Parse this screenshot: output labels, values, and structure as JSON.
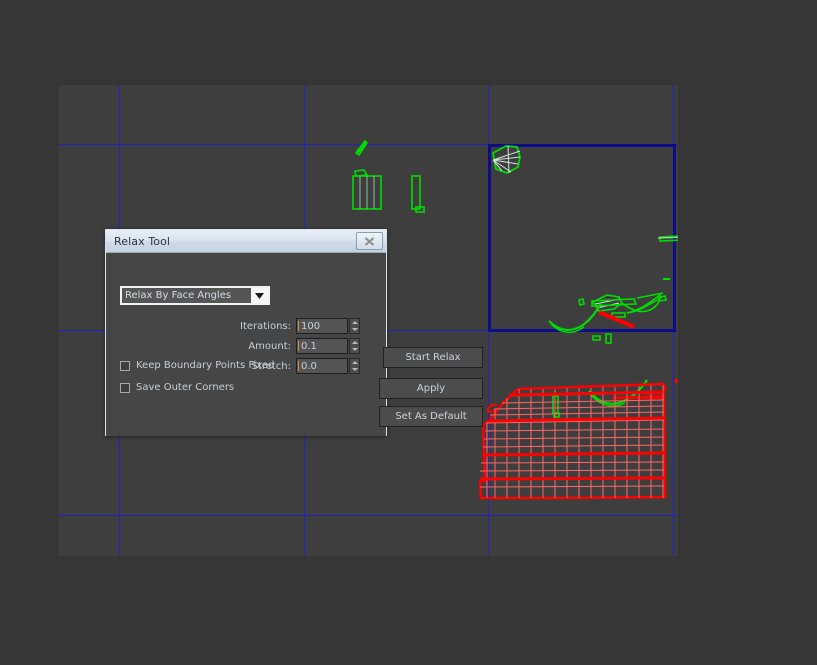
{
  "viewport": {
    "name": "uv-editor-viewport",
    "background_color": "#3e3e3e",
    "page_background_color": "#363636",
    "grid_color": "#2222c8",
    "active_quadrant_border_color": "#0d0d8c",
    "uv_shell_color": "#00dd00",
    "selected_shell_color": "#ff0000"
  },
  "dialog": {
    "title": "Relax Tool",
    "close_icon": "close-icon",
    "method_dropdown": {
      "selected": "Relax By Face Angles",
      "arrow_icon": "chevron-down-icon"
    },
    "fields": [
      {
        "label": "Iterations:",
        "value": "100",
        "spinner_up_icon": "triangle-up-icon",
        "spinner_down_icon": "triangle-down-icon"
      },
      {
        "label": "Amount:",
        "value": "0.1",
        "spinner_up_icon": "triangle-up-icon",
        "spinner_down_icon": "triangle-down-icon"
      },
      {
        "label": "Stretch:",
        "value": "0.0",
        "spinner_up_icon": "triangle-up-icon",
        "spinner_down_icon": "triangle-down-icon"
      }
    ],
    "checkboxes": [
      {
        "label": "Keep Boundary Points Fixed",
        "checked": false
      },
      {
        "label": "Save Outer Corners",
        "checked": false
      }
    ],
    "buttons": [
      {
        "label": "Start Relax"
      },
      {
        "label": "Apply"
      },
      {
        "label": "Set As Default"
      }
    ],
    "colors": {
      "body": "#464646",
      "titlebar_text": "#2b3440",
      "border": "#dde3ea",
      "input_bg": "#545454",
      "caret": "#d98a3a"
    }
  }
}
